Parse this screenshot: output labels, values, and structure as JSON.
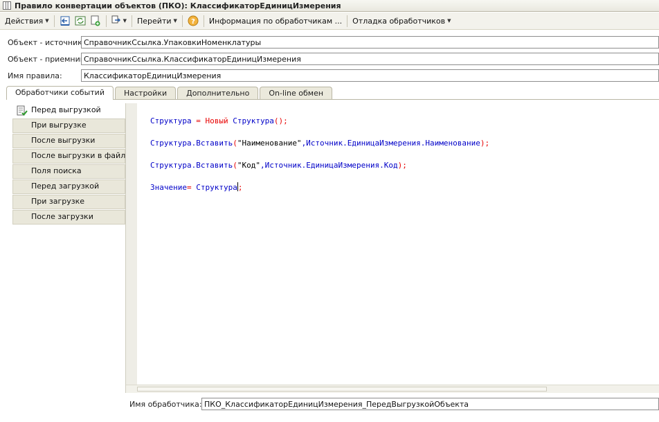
{
  "window": {
    "title": "Правило конвертации объектов (ПКО): КлассификаторЕдиницИзмерения"
  },
  "toolbar": {
    "actions_label": "Действия",
    "goto_label": "Перейти",
    "info_label": "Информация по обработчикам ...",
    "debug_label": "Отладка обработчиков",
    "icons": [
      "back-icon",
      "refresh-icon",
      "copy-icon",
      "transfer-icon",
      "help-icon"
    ]
  },
  "form": {
    "source_label": "Объект - источник:",
    "source_value": "СправочникСсылка.УпаковкиНоменклатуры",
    "target_label": "Объект - приемник:",
    "target_value": "СправочникСсылка.КлассификаторЕдиницИзмерения",
    "rule_name_label": "Имя правила:",
    "rule_name_value": "КлассификаторЕдиницИзмерения"
  },
  "tabs": [
    {
      "label": "Обработчики событий",
      "active": true
    },
    {
      "label": "Настройки",
      "active": false
    },
    {
      "label": "Дополнительно",
      "active": false
    },
    {
      "label": "On-line обмен",
      "active": false
    }
  ],
  "events": [
    {
      "label": "Перед выгрузкой",
      "selected": true
    },
    {
      "label": "При выгрузке",
      "selected": false
    },
    {
      "label": "После выгрузки",
      "selected": false
    },
    {
      "label": "После выгрузки в файл",
      "selected": false
    },
    {
      "label": "Поля поиска",
      "selected": false
    },
    {
      "label": "Перед загрузкой",
      "selected": false
    },
    {
      "label": "При загрузке",
      "selected": false
    },
    {
      "label": "После загрузки",
      "selected": false
    }
  ],
  "code": {
    "line1_a": "Структура",
    "line1_b": " = ",
    "line1_c": "Новый",
    "line1_d": " Структура",
    "line1_e": "();",
    "line2_a": "Структура.Вставить",
    "line2_b": "(",
    "line2_c": "\"Наименование\"",
    "line2_d": ",Источник.ЕдиницаИзмерения.Наименование",
    "line2_e": ");",
    "line3_a": "Структура.Вставить",
    "line3_b": "(",
    "line3_c": "\"Код\"",
    "line3_d": ",Источник.ЕдиницаИзмерения.Код",
    "line3_e": ");",
    "line4_a": "Значение",
    "line4_b": "= ",
    "line4_c": "Структура",
    "line4_d": ";"
  },
  "handler": {
    "label": "Имя обработчика:",
    "value": "ПКО_КлассификаторЕдиницИзмерения_ПередВыгрузкойОбъекта"
  }
}
